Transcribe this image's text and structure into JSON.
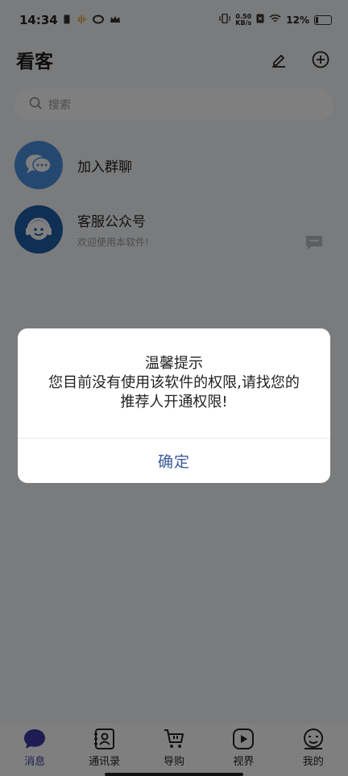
{
  "status_bar": {
    "time": "14:34",
    "net_speed_value": "0.50",
    "net_speed_unit": "KB/s",
    "battery": "12%"
  },
  "header": {
    "title": "看客"
  },
  "search": {
    "placeholder": "搜索"
  },
  "chats": [
    {
      "name": "加入群聊",
      "preview": ""
    },
    {
      "name": "客服公众号",
      "preview": "欢迎使用本软件!"
    }
  ],
  "dialog": {
    "title": "温馨提示",
    "message_line1": "您目前没有使用该软件的权限,请找您的",
    "message_line2": "推荐人开通权限!",
    "confirm_label": "确定"
  },
  "tabs": [
    {
      "label": "消息",
      "icon": "chat-bubble-icon"
    },
    {
      "label": "通讯录",
      "icon": "contacts-icon"
    },
    {
      "label": "导购",
      "icon": "cart-icon"
    },
    {
      "label": "视界",
      "icon": "play-icon"
    },
    {
      "label": "我的",
      "icon": "profile-icon"
    }
  ],
  "colors": {
    "accent": "#3a3aa8",
    "dialog_button": "#3a5a9a",
    "avatar_blue": "#4a90e2"
  }
}
